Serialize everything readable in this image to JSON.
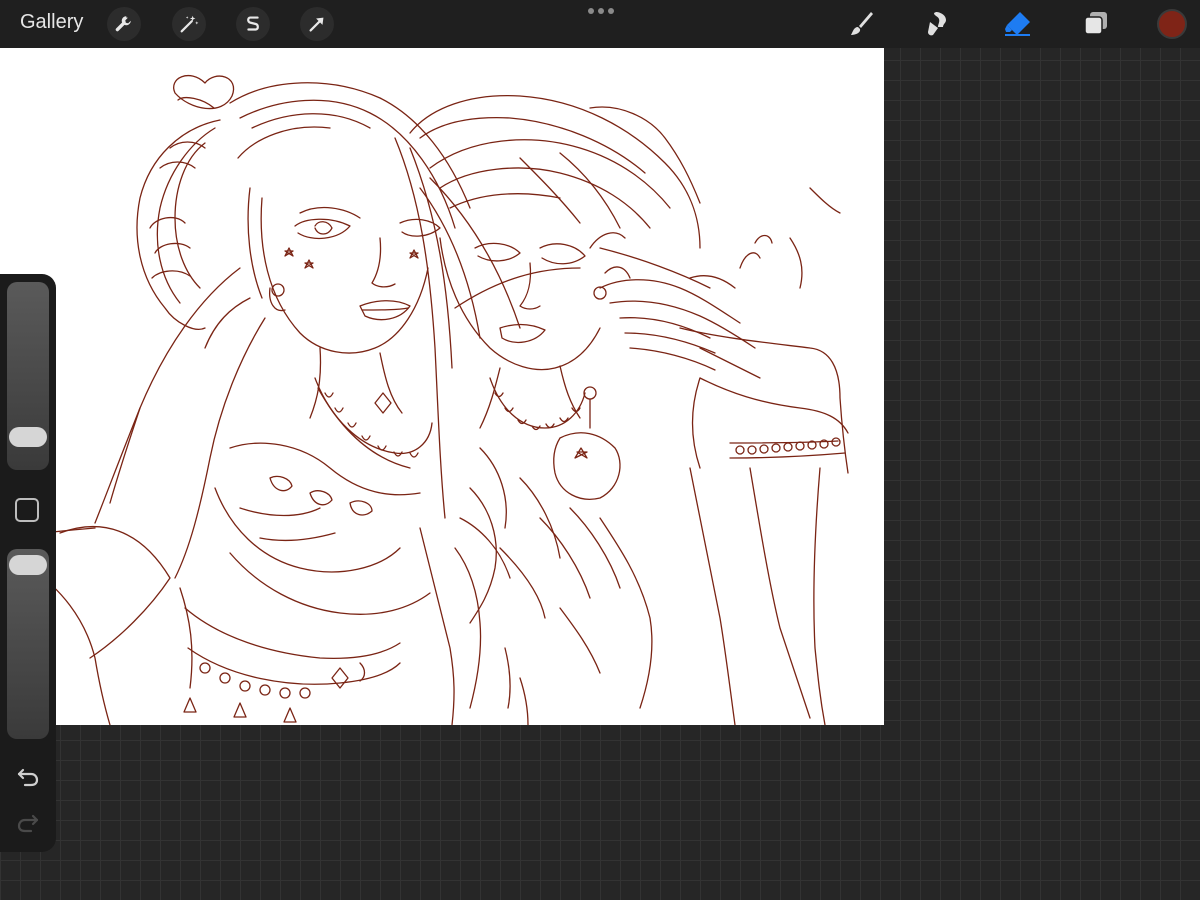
{
  "toolbar": {
    "gallery_label": "Gallery",
    "left_tools": [
      "wrench-icon",
      "magic-wand-icon",
      "selection-icon",
      "transform-arrow-icon"
    ],
    "right_tools": [
      "brush-icon",
      "smudge-icon",
      "eraser-icon",
      "layers-icon"
    ],
    "active_tool": "eraser-icon",
    "active_tool_color": "#1e7cf2",
    "current_color": "#7f2417"
  },
  "canvas": {
    "background": "#ffffff",
    "stroke_color": "#7a2414"
  },
  "sidebar": {
    "brush_size_level": 0.87,
    "opacity_level": 0.0,
    "controls": [
      "modify-square-icon",
      "undo-icon",
      "redo-icon"
    ]
  }
}
